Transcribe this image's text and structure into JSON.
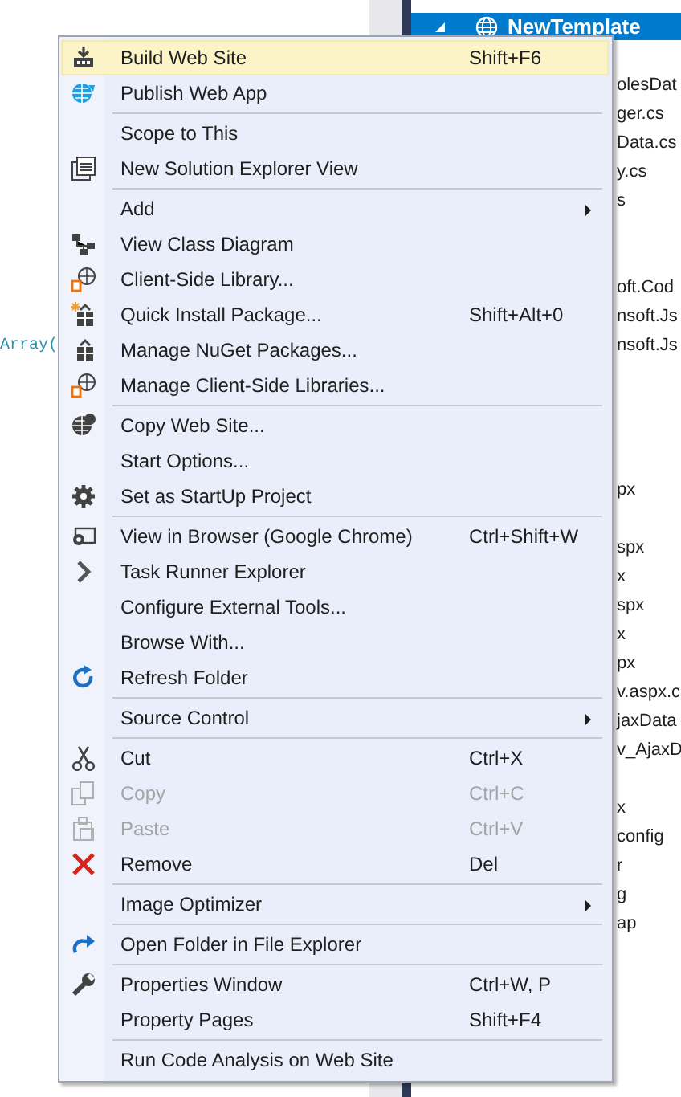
{
  "editor": {
    "code_line": "Array("
  },
  "solution_explorer": {
    "project": {
      "label": "NewTemplate",
      "selected": true,
      "expanded": true
    },
    "groups": [
      [
        "olesDat",
        "ger.cs",
        "Data.cs",
        "y.cs",
        "s"
      ],
      [
        "oft.Cod",
        "nsoft.Js",
        "nsoft.Js"
      ],
      [
        "px"
      ],
      [
        "spx",
        "x",
        "spx",
        "x",
        "px",
        "v.aspx.c",
        "jaxData",
        "v_AjaxD"
      ],
      [
        "x",
        "config",
        "r",
        "g",
        "ap"
      ]
    ]
  },
  "context_menu": {
    "sections": [
      [
        {
          "label": "Build Web Site",
          "shortcut": "Shift+F6",
          "selected": true,
          "disabled": false,
          "submenu": false
        },
        {
          "label": "Publish Web App",
          "selected": false,
          "disabled": false,
          "submenu": false
        }
      ],
      [
        {
          "label": "Scope to This",
          "selected": false,
          "disabled": false,
          "submenu": false
        },
        {
          "label": "New Solution Explorer View",
          "selected": false,
          "disabled": false,
          "submenu": false
        }
      ],
      [
        {
          "label": "Add",
          "selected": false,
          "disabled": false,
          "submenu": true
        },
        {
          "label": "View Class Diagram",
          "selected": false,
          "disabled": false,
          "submenu": false
        },
        {
          "label": "Client-Side Library...",
          "selected": false,
          "disabled": false,
          "submenu": false
        },
        {
          "label": "Quick Install Package...",
          "shortcut": "Shift+Alt+0",
          "selected": false,
          "disabled": false,
          "submenu": false
        },
        {
          "label": "Manage NuGet Packages...",
          "selected": false,
          "disabled": false,
          "submenu": false
        },
        {
          "label": "Manage Client-Side Libraries...",
          "selected": false,
          "disabled": false,
          "submenu": false
        }
      ],
      [
        {
          "label": "Copy Web Site...",
          "selected": false,
          "disabled": false,
          "submenu": false
        },
        {
          "label": "Start Options...",
          "selected": false,
          "disabled": false,
          "submenu": false
        },
        {
          "label": "Set as StartUp Project",
          "selected": false,
          "disabled": false,
          "submenu": false
        }
      ],
      [
        {
          "label": "View in Browser (Google Chrome)",
          "shortcut": "Ctrl+Shift+W",
          "selected": false,
          "disabled": false,
          "submenu": false
        },
        {
          "label": "Task Runner Explorer",
          "selected": false,
          "disabled": false,
          "submenu": false
        },
        {
          "label": "Configure External Tools...",
          "selected": false,
          "disabled": false,
          "submenu": false
        },
        {
          "label": "Browse With...",
          "selected": false,
          "disabled": false,
          "submenu": false
        },
        {
          "label": "Refresh Folder",
          "selected": false,
          "disabled": false,
          "submenu": false
        }
      ],
      [
        {
          "label": "Source Control",
          "selected": false,
          "disabled": false,
          "submenu": true
        }
      ],
      [
        {
          "label": "Cut",
          "shortcut": "Ctrl+X",
          "selected": false,
          "disabled": false,
          "submenu": false
        },
        {
          "label": "Copy",
          "shortcut": "Ctrl+C",
          "selected": false,
          "disabled": true,
          "submenu": false
        },
        {
          "label": "Paste",
          "shortcut": "Ctrl+V",
          "selected": false,
          "disabled": true,
          "submenu": false
        },
        {
          "label": "Remove",
          "shortcut": "Del",
          "selected": false,
          "disabled": false,
          "submenu": false
        }
      ],
      [
        {
          "label": "Image Optimizer",
          "selected": false,
          "disabled": false,
          "submenu": true
        }
      ],
      [
        {
          "label": "Open Folder in File Explorer",
          "selected": false,
          "disabled": false,
          "submenu": false
        }
      ],
      [
        {
          "label": "Properties Window",
          "shortcut": "Ctrl+W, P",
          "selected": false,
          "disabled": false,
          "submenu": false
        },
        {
          "label": "Property Pages",
          "shortcut": "Shift+F4",
          "selected": false,
          "disabled": false,
          "submenu": false
        }
      ],
      [
        {
          "label": "Run Code Analysis on Web Site",
          "selected": false,
          "disabled": false,
          "submenu": false
        }
      ]
    ]
  }
}
